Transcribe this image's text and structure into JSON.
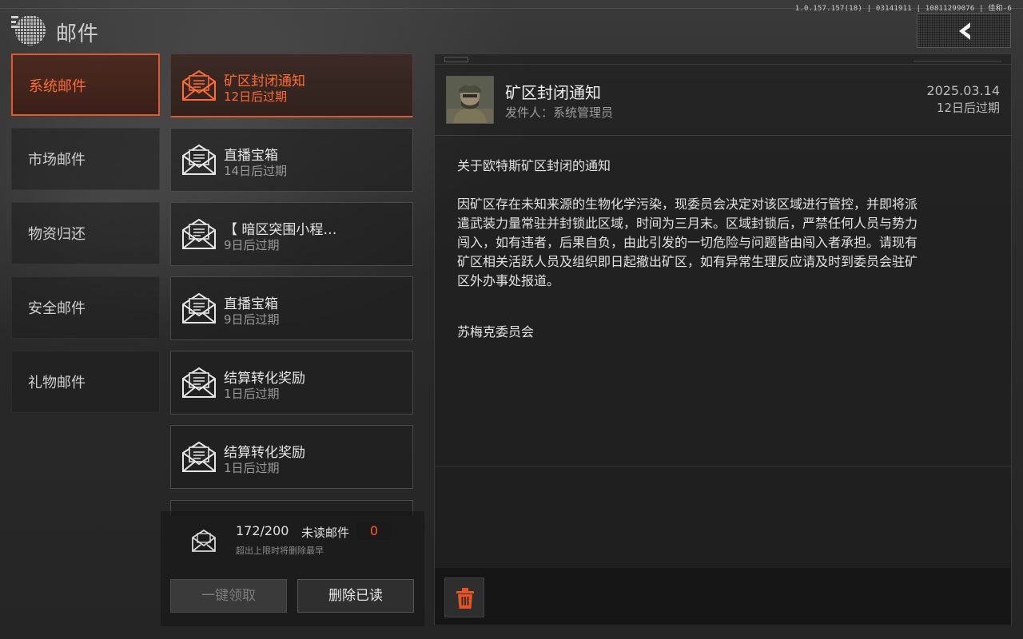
{
  "version_text": "1.0.157.157(18) | 03141911 | 10811299076 | 佳和-6",
  "header": {
    "title": "邮件",
    "logo_icon": "globe-logo-icon"
  },
  "back_button": {
    "icon": "chevron-left-icon"
  },
  "categories": [
    {
      "label": "系统邮件",
      "active": true
    },
    {
      "label": "市场邮件",
      "active": false
    },
    {
      "label": "物资归还",
      "active": false
    },
    {
      "label": "安全邮件",
      "active": false
    },
    {
      "label": "礼物邮件",
      "active": false
    }
  ],
  "mails": [
    {
      "title": "矿区封闭通知",
      "expiry": "12日后过期",
      "active": true
    },
    {
      "title": "直播宝箱",
      "expiry": "14日后过期",
      "active": false
    },
    {
      "title": "【 暗区突围小程…",
      "expiry": "9日后过期",
      "active": false
    },
    {
      "title": "直播宝箱",
      "expiry": "9日后过期",
      "active": false
    },
    {
      "title": "结算转化奖励",
      "expiry": "1日后过期",
      "active": false
    },
    {
      "title": "结算转化奖励",
      "expiry": "1日后过期",
      "active": false
    }
  ],
  "status": {
    "count": "172/200",
    "unread_label": "未读邮件",
    "unread_count": "0",
    "note": "超出上限时将删除最早"
  },
  "buttons": {
    "claim_all": "一键领取",
    "delete_read": "删除已读"
  },
  "detail": {
    "title": "矿区封闭通知",
    "sender": "发件人：系统管理员",
    "date": "2025.03.14",
    "expiry": "12日后过期",
    "body_heading": "关于欧特斯矿区封闭的通知",
    "body_line1": "因矿区存在未知来源的生物化学污染，现委员会决定对该区域进行管控，并即将派",
    "body_line2": "遣武装力量常驻并封锁此区域，时间为三月末。区域封锁后，严禁任何人员与势力",
    "body_line3": "闯入，如有违者，后果自负，由此引发的一切危险与问题皆由闯入者承担。请现有",
    "body_line4": "矿区相关活跃人员及组织即日起撤出矿区，如有异常生理反应请及时到委员会驻矿",
    "body_line5": "区外办事处报道。",
    "signature": "苏梅克委员会"
  },
  "colors": {
    "accent": "#e0592a",
    "accent_text": "#ff6a35",
    "trash": "#e8531f"
  }
}
